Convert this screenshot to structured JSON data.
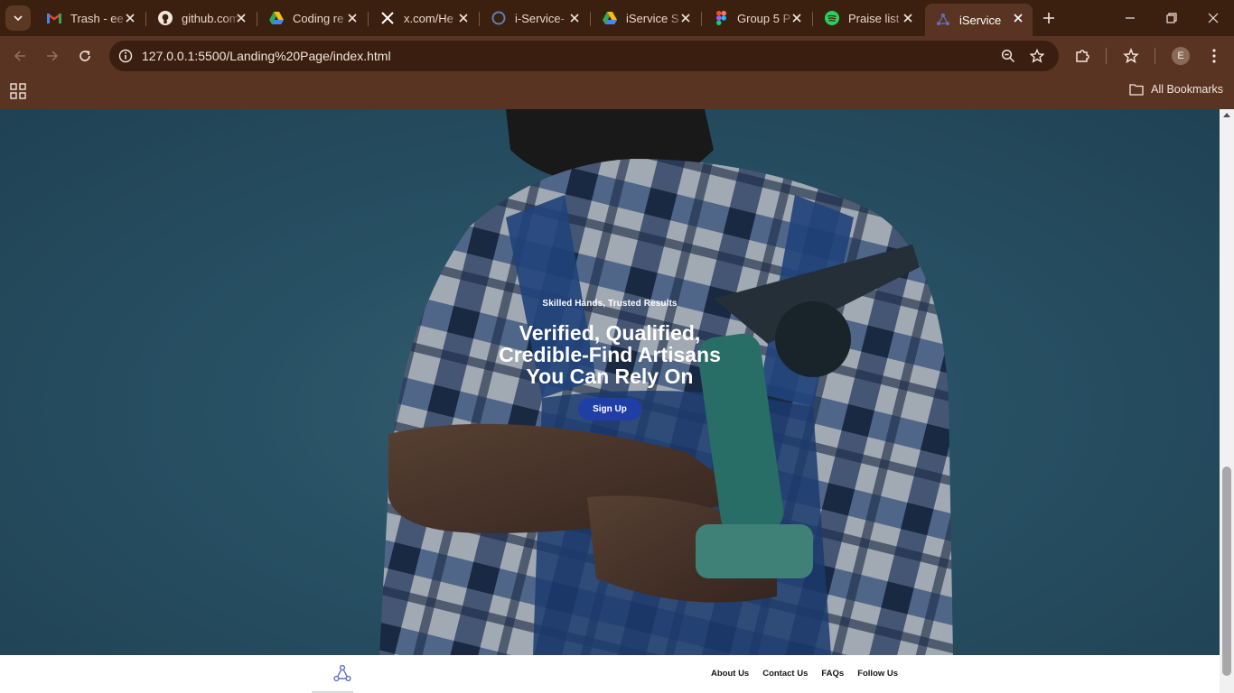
{
  "browser": {
    "tabs": [
      {
        "title": "Trash - ee",
        "icon": "gmail-icon"
      },
      {
        "title": "github.com",
        "icon": "github-icon"
      },
      {
        "title": "Coding re",
        "icon": "google-drive-icon"
      },
      {
        "title": "x.com/He",
        "icon": "x-icon"
      },
      {
        "title": "i-Service-",
        "icon": "loading-icon"
      },
      {
        "title": "iService S",
        "icon": "google-drive-icon"
      },
      {
        "title": "Group 5 P",
        "icon": "figma-icon"
      },
      {
        "title": "Praise list",
        "icon": "spotify-icon"
      },
      {
        "title": "iService",
        "icon": "iservice-logo-icon",
        "active": true
      }
    ],
    "url": "127.0.0.1:5500/Landing%20Page/index.html",
    "profile_initial": "E",
    "bookmarks_label": "All Bookmarks"
  },
  "hero": {
    "tagline": "Skilled Hands, Trusted Results",
    "headline_lines": [
      "Verified, Qualified,",
      "Credible-Find Artisans",
      "You Can Rely On"
    ],
    "cta": "Sign Up"
  },
  "footer": {
    "links": [
      "About Us",
      "Contact Us",
      "FAQs",
      "Follow Us"
    ]
  },
  "colors": {
    "accent": "#1f3fa6",
    "browser_frame": "#3b200f",
    "toolbar": "#5a3422",
    "hero_bg": "#2e5b70"
  },
  "scroll_position_fraction": 0.75
}
